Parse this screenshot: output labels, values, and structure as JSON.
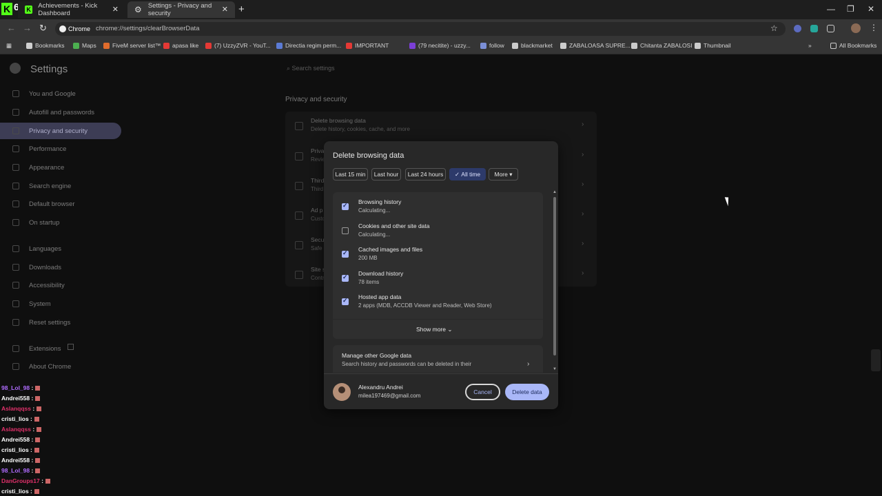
{
  "overlay": {
    "kick_letter": "K",
    "kick_count": "671"
  },
  "tabs": [
    {
      "label": "Achievements - Kick Dashboard",
      "favicon": "kick-icon"
    },
    {
      "label": "Settings - Privacy and security",
      "favicon": "gear-icon"
    }
  ],
  "omnibox": {
    "chip": "Chrome",
    "url": "chrome://settings/clearBrowserData"
  },
  "bookmarks": [
    {
      "label": "Bookmarks",
      "color": "#cfcfcf"
    },
    {
      "label": "Maps",
      "color": "#4caf50"
    },
    {
      "label": "FiveM server list™",
      "color": "#e06c2c"
    },
    {
      "label": "apasa like",
      "color": "#e53935"
    },
    {
      "label": "(7) UzzyZVR - YouT...",
      "color": "#e53935"
    },
    {
      "label": "Directia regim perm...",
      "color": "#5b7bd5"
    },
    {
      "label": "IMPORTANT",
      "color": "#e53935"
    },
    {
      "label": "(79 necitite) - uzzy...",
      "color": "#7b3fd6"
    },
    {
      "label": "follow",
      "color": "#7b8fd6"
    },
    {
      "label": "blackmarket",
      "color": "#cccccc"
    },
    {
      "label": "ZABALOASA SUPRE...",
      "color": "#cccccc"
    },
    {
      "label": "Chitanta ZABALOSI",
      "color": "#cccccc"
    },
    {
      "label": "Thumbnail",
      "color": "#cccccc"
    }
  ],
  "bookmarks_more": "»",
  "all_bookmarks": "All Bookmarks",
  "settings": {
    "title": "Settings",
    "search_placeholder": "Search settings",
    "nav": [
      "You and Google",
      "Autofill and passwords",
      "Privacy and security",
      "Performance",
      "Appearance",
      "Search engine",
      "Default browser",
      "On startup",
      "Languages",
      "Downloads",
      "Accessibility",
      "System",
      "Reset settings",
      "Extensions",
      "About Chrome"
    ],
    "section_heading": "Privacy and security",
    "rows": [
      {
        "title": "Delete browsing data",
        "sub": "Delete history, cookies, cache, and more"
      },
      {
        "title": "Priva",
        "sub": "Revie"
      },
      {
        "title": "Third",
        "sub": "Third"
      },
      {
        "title": "Ad p",
        "sub": "Custo"
      },
      {
        "title": "Secu",
        "sub": "Safe"
      },
      {
        "title": "Site s",
        "sub": "Contr"
      }
    ]
  },
  "chat": [
    {
      "user": "98_Lol_98",
      "color": "#b06cff"
    },
    {
      "user": "Andrei558",
      "color": "#ffffff"
    },
    {
      "user": "Aslanqqss",
      "color": "#e0306a"
    },
    {
      "user": "cristi_lios",
      "color": "#ffffff"
    },
    {
      "user": "Aslanqqss",
      "color": "#e0306a"
    },
    {
      "user": "Andrei558",
      "color": "#ffffff"
    },
    {
      "user": "cristi_lios",
      "color": "#ffffff"
    },
    {
      "user": "Andrei558",
      "color": "#ffffff"
    },
    {
      "user": "98_Lol_98",
      "color": "#b06cff"
    },
    {
      "user": "DanGroups17",
      "color": "#e0306a"
    },
    {
      "user": "cristi_lios",
      "color": "#ffffff"
    }
  ],
  "dialog": {
    "title": "Delete browsing data",
    "time_ranges": [
      "Last 15 min",
      "Last hour",
      "Last 24 hours",
      "All time",
      "More"
    ],
    "selected_range": "All time",
    "items": [
      {
        "title": "Browsing history",
        "sub": "Calculating...",
        "checked": true
      },
      {
        "title": "Cookies and other site data",
        "sub": "Calculating...",
        "checked": false
      },
      {
        "title": "Cached images and files",
        "sub": "200 MB",
        "checked": true
      },
      {
        "title": "Download history",
        "sub": "78 items",
        "checked": true
      },
      {
        "title": "Hosted app data",
        "sub": "2 apps (MDB, ACCDB Viewer and Reader, Web Store)",
        "checked": true
      }
    ],
    "show_more": "Show more",
    "manage_title": "Manage other Google data",
    "manage_sub": "Search history and passwords can be deleted in their",
    "account_name": "Alexandru Andrei",
    "account_email": "milea197469@gmail.com",
    "cancel": "Cancel",
    "delete": "Delete data"
  }
}
